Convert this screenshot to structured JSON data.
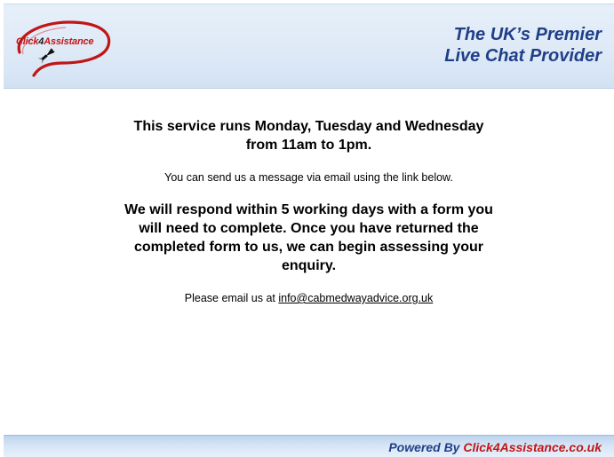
{
  "header": {
    "logo": {
      "text_part1": "Click",
      "text_part2": "4",
      "text_part3": "Assistance"
    },
    "tagline_line1": "The UK’s Premier",
    "tagline_line2": "Live Chat Provider"
  },
  "content": {
    "hours": "This service runs Monday, Tuesday and Wednesday from 11am to 1pm.",
    "email_intro": "You can send us a message via email using the link below.",
    "respond": "We will respond within 5 working days with a form you will need to complete. Once you have returned the completed form to us, we can begin assessing your enquiry.",
    "email_prefix": "Please email us at ",
    "email_link": "info@cabmedwayadvice.org.uk"
  },
  "footer": {
    "powered_prefix": "Powered By ",
    "powered_brand": "Click4Assistance.co.uk"
  },
  "colors": {
    "brand_blue": "#1f3f88",
    "brand_red": "#c01616"
  },
  "icons": {
    "logo_mark": "rocket-icon"
  }
}
